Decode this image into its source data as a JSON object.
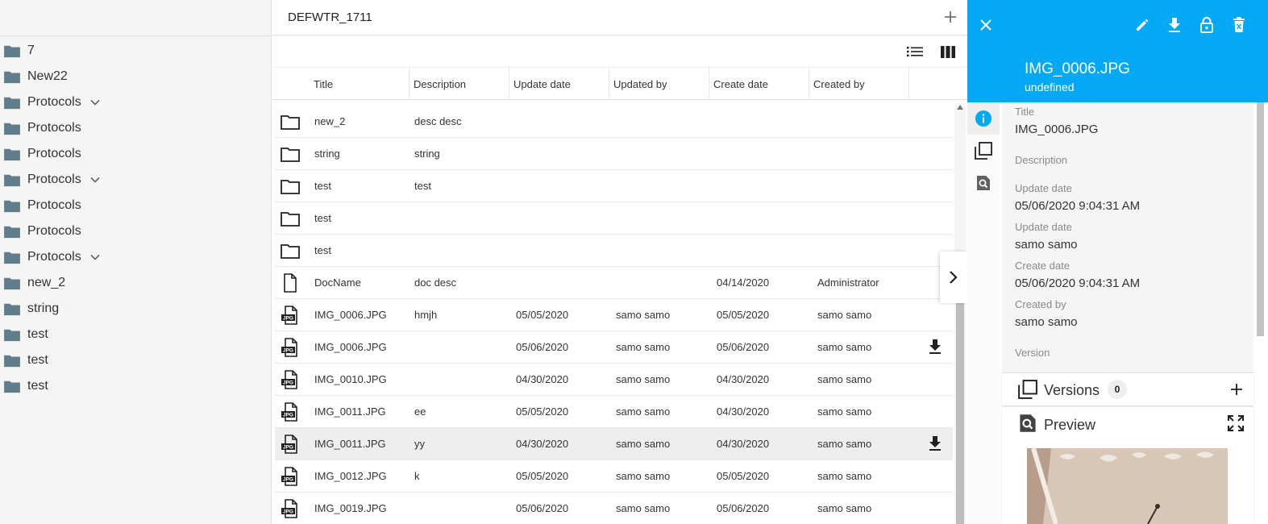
{
  "tree": {
    "items": [
      {
        "label": "7",
        "expandable": false
      },
      {
        "label": "New22",
        "expandable": false
      },
      {
        "label": "Protocols",
        "expandable": true
      },
      {
        "label": "Protocols",
        "expandable": false
      },
      {
        "label": "Protocols",
        "expandable": false
      },
      {
        "label": "Protocols",
        "expandable": true
      },
      {
        "label": "Protocols",
        "expandable": false
      },
      {
        "label": "Protocols",
        "expandable": false
      },
      {
        "label": "Protocols",
        "expandable": true
      },
      {
        "label": "new_2",
        "expandable": false
      },
      {
        "label": "string",
        "expandable": false
      },
      {
        "label": "test",
        "expandable": false
      },
      {
        "label": "test",
        "expandable": false
      },
      {
        "label": "test",
        "expandable": false
      }
    ]
  },
  "main": {
    "title": "DEFWTR_1711",
    "columns": [
      "Title",
      "Description",
      "Update date",
      "Updated by",
      "Create date",
      "Created by"
    ],
    "rows": [
      {
        "type": "folder",
        "title": "new_2",
        "description": "desc desc",
        "update_date": "",
        "updated_by": "",
        "create_date": "",
        "created_by": "",
        "download": false
      },
      {
        "type": "folder",
        "title": "string",
        "description": "string",
        "update_date": "",
        "updated_by": "",
        "create_date": "",
        "created_by": "",
        "download": false
      },
      {
        "type": "folder",
        "title": "test",
        "description": "test",
        "update_date": "",
        "updated_by": "",
        "create_date": "",
        "created_by": "",
        "download": false
      },
      {
        "type": "folder",
        "title": "test",
        "description": "",
        "update_date": "",
        "updated_by": "",
        "create_date": "",
        "created_by": "",
        "download": false
      },
      {
        "type": "folder",
        "title": "test",
        "description": "",
        "update_date": "",
        "updated_by": "",
        "create_date": "",
        "created_by": "",
        "download": false
      },
      {
        "type": "doc",
        "title": "DocName",
        "description": "doc desc",
        "update_date": "",
        "updated_by": "",
        "create_date": "04/14/2020",
        "created_by": "Administrator",
        "download": false
      },
      {
        "type": "jpg",
        "title": "IMG_0006.JPG",
        "description": "hmjh",
        "update_date": "05/05/2020",
        "updated_by": "samo samo",
        "create_date": "05/05/2020",
        "created_by": "samo samo",
        "download": false
      },
      {
        "type": "jpg",
        "title": "IMG_0006.JPG",
        "description": "",
        "update_date": "05/06/2020",
        "updated_by": "samo samo",
        "create_date": "05/06/2020",
        "created_by": "samo samo",
        "download": true
      },
      {
        "type": "jpg",
        "title": "IMG_0010.JPG",
        "description": "",
        "update_date": "04/30/2020",
        "updated_by": "samo samo",
        "create_date": "04/30/2020",
        "created_by": "samo samo",
        "download": false
      },
      {
        "type": "jpg",
        "title": "IMG_0011.JPG",
        "description": "ee",
        "update_date": "05/05/2020",
        "updated_by": "samo samo",
        "create_date": "04/30/2020",
        "created_by": "samo samo",
        "download": false
      },
      {
        "type": "jpg",
        "title": "IMG_0011.JPG",
        "description": "yy",
        "update_date": "04/30/2020",
        "updated_by": "samo samo",
        "create_date": "04/30/2020",
        "created_by": "samo samo",
        "download": true,
        "selected": true
      },
      {
        "type": "jpg",
        "title": "IMG_0012.JPG",
        "description": "k",
        "update_date": "05/05/2020",
        "updated_by": "samo samo",
        "create_date": "05/05/2020",
        "created_by": "samo samo",
        "download": false
      },
      {
        "type": "jpg",
        "title": "IMG_0019.JPG",
        "description": "",
        "update_date": "05/06/2020",
        "updated_by": "samo samo",
        "create_date": "05/06/2020",
        "created_by": "samo samo",
        "download": false
      }
    ]
  },
  "panel": {
    "title": "IMG_0006.JPG",
    "subtitle": "undefined",
    "fields": [
      {
        "label": "Title",
        "value": "IMG_0006.JPG"
      },
      {
        "label": "Description",
        "value": ""
      },
      {
        "label": "Update date",
        "value": "05/06/2020 9:04:31 AM"
      },
      {
        "label": "Update date",
        "value": "samo samo"
      },
      {
        "label": "Create date",
        "value": "05/06/2020 9:04:31 AM"
      },
      {
        "label": "Created by",
        "value": "samo samo"
      },
      {
        "label": "Version",
        "value": ""
      }
    ],
    "versions_label": "Versions",
    "versions_count": "0",
    "preview_label": "Preview"
  },
  "colors": {
    "accent": "#03a9f4",
    "folder_gray": "#607d8b",
    "selected_row": "#eeeeee"
  }
}
